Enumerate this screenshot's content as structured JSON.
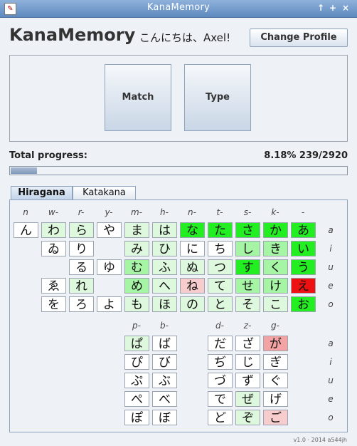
{
  "window": {
    "title": "KanaMemory",
    "app_icon": "kana-icon",
    "buttons": [
      "↑",
      "+",
      "×"
    ]
  },
  "header": {
    "app_name": "KanaMemory",
    "greeting": "こんにちは、Axel!",
    "change_profile_label": "Change Profile"
  },
  "modes": {
    "match_label": "Match",
    "type_label": "Type"
  },
  "progress": {
    "label": "Total progress:",
    "value_text": "8.18% 239/2920",
    "fraction": 0.0818
  },
  "tabs": [
    {
      "label": "Hiragana",
      "active": true
    },
    {
      "label": "Katakana",
      "active": false
    }
  ],
  "colors": {
    "white": "#ffffff",
    "mastered": "#22ee22",
    "learned": "#a5f5a5",
    "learning": "#ddf8dd",
    "weak": "#f6cccc",
    "poor": "#f3a3a3",
    "failed": "#ee1111"
  },
  "grid_main": {
    "columns": [
      "n",
      "w-",
      "r-",
      "y-",
      "m-",
      "h-",
      "n-",
      "t-",
      "s-",
      "k-",
      "-"
    ],
    "rows": [
      "a",
      "i",
      "u",
      "e",
      "o"
    ],
    "cells": [
      [
        {
          "k": "ん",
          "s": "white"
        },
        {
          "k": "わ",
          "s": "learning"
        },
        {
          "k": "ら",
          "s": "learning"
        },
        {
          "k": "や",
          "s": "white"
        },
        {
          "k": "ま",
          "s": "learning"
        },
        {
          "k": "は",
          "s": "learning"
        },
        {
          "k": "な",
          "s": "mastered"
        },
        {
          "k": "た",
          "s": "mastered"
        },
        {
          "k": "さ",
          "s": "mastered"
        },
        {
          "k": "か",
          "s": "mastered"
        },
        {
          "k": "あ",
          "s": "mastered"
        }
      ],
      [
        null,
        {
          "k": "ゐ",
          "s": "white"
        },
        {
          "k": "り",
          "s": "white"
        },
        null,
        {
          "k": "み",
          "s": "learning"
        },
        {
          "k": "ひ",
          "s": "learning"
        },
        {
          "k": "に",
          "s": "white"
        },
        {
          "k": "ち",
          "s": "white"
        },
        {
          "k": "し",
          "s": "learned"
        },
        {
          "k": "き",
          "s": "learned"
        },
        {
          "k": "い",
          "s": "mastered"
        }
      ],
      [
        null,
        null,
        {
          "k": "る",
          "s": "white"
        },
        {
          "k": "ゆ",
          "s": "white"
        },
        {
          "k": "む",
          "s": "learned"
        },
        {
          "k": "ふ",
          "s": "learning"
        },
        {
          "k": "ぬ",
          "s": "learning"
        },
        {
          "k": "つ",
          "s": "learning"
        },
        {
          "k": "す",
          "s": "mastered"
        },
        {
          "k": "く",
          "s": "learned"
        },
        {
          "k": "う",
          "s": "mastered"
        }
      ],
      [
        null,
        {
          "k": "ゑ",
          "s": "white"
        },
        {
          "k": "れ",
          "s": "learning"
        },
        null,
        {
          "k": "め",
          "s": "learned"
        },
        {
          "k": "へ",
          "s": "learning"
        },
        {
          "k": "ね",
          "s": "weak"
        },
        {
          "k": "て",
          "s": "learning"
        },
        {
          "k": "せ",
          "s": "learned"
        },
        {
          "k": "け",
          "s": "learned"
        },
        {
          "k": "え",
          "s": "failed"
        }
      ],
      [
        null,
        {
          "k": "を",
          "s": "white"
        },
        {
          "k": "ろ",
          "s": "white"
        },
        {
          "k": "よ",
          "s": "white"
        },
        {
          "k": "も",
          "s": "learning"
        },
        {
          "k": "ほ",
          "s": "learning"
        },
        {
          "k": "の",
          "s": "learning"
        },
        {
          "k": "と",
          "s": "learning"
        },
        {
          "k": "そ",
          "s": "learning"
        },
        {
          "k": "こ",
          "s": "learning"
        },
        {
          "k": "お",
          "s": "mastered"
        }
      ]
    ]
  },
  "grid_voiced": {
    "columns": [
      null,
      null,
      null,
      null,
      "p-",
      "b-",
      null,
      "d-",
      "z-",
      "g-",
      null
    ],
    "cells": [
      [
        null,
        null,
        null,
        null,
        {
          "k": "ぱ",
          "s": "learning"
        },
        {
          "k": "ば",
          "s": "white"
        },
        null,
        {
          "k": "だ",
          "s": "white"
        },
        {
          "k": "ざ",
          "s": "white"
        },
        {
          "k": "が",
          "s": "poor"
        },
        null
      ],
      [
        null,
        null,
        null,
        null,
        {
          "k": "ぴ",
          "s": "white"
        },
        {
          "k": "び",
          "s": "white"
        },
        null,
        {
          "k": "ぢ",
          "s": "white"
        },
        {
          "k": "じ",
          "s": "white"
        },
        {
          "k": "ぎ",
          "s": "white"
        },
        null
      ],
      [
        null,
        null,
        null,
        null,
        {
          "k": "ぷ",
          "s": "white"
        },
        {
          "k": "ぶ",
          "s": "white"
        },
        null,
        {
          "k": "づ",
          "s": "white"
        },
        {
          "k": "ず",
          "s": "white"
        },
        {
          "k": "ぐ",
          "s": "white"
        },
        null
      ],
      [
        null,
        null,
        null,
        null,
        {
          "k": "ぺ",
          "s": "white"
        },
        {
          "k": "べ",
          "s": "white"
        },
        null,
        {
          "k": "で",
          "s": "white"
        },
        {
          "k": "ぜ",
          "s": "learning"
        },
        {
          "k": "げ",
          "s": "white"
        },
        null
      ],
      [
        null,
        null,
        null,
        null,
        {
          "k": "ぽ",
          "s": "white"
        },
        {
          "k": "ぼ",
          "s": "white"
        },
        null,
        {
          "k": "ど",
          "s": "white"
        },
        {
          "k": "ぞ",
          "s": "learning"
        },
        {
          "k": "ご",
          "s": "weak"
        },
        null
      ]
    ]
  },
  "version": "v1.0 · 2014 a544jh"
}
